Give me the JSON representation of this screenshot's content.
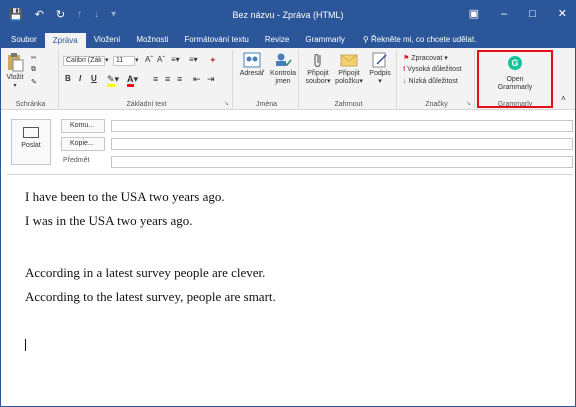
{
  "titlebar": {
    "title": "Bez názvu - Zpráva (HTML)",
    "save_icon": "save-icon",
    "undo_icon": "undo-icon",
    "redo_icon": "redo-icon"
  },
  "tabs": [
    "Soubor",
    "Zpráva",
    "Vložení",
    "Možnosti",
    "Formátování textu",
    "Revize",
    "Grammarly"
  ],
  "tell_me": "Řekněte mi, co chcete udělat.",
  "ribbon": {
    "paste": "Vložit",
    "clipboard_group": "Schránka",
    "font_name": "Calibri (Zák",
    "font_size": "11",
    "basic_text_group": "Základní text",
    "address_book": "Adresář",
    "check_names": [
      "Kontrola",
      "jmen"
    ],
    "names_group": "Jména",
    "attach_file": [
      "Připojit",
      "soubor"
    ],
    "attach_item": [
      "Připojit",
      "položku"
    ],
    "signature": "Podpis",
    "include_group": "Zahrnout",
    "follow_up": "Zpracovat",
    "high_importance": "Vysoká důležitost",
    "low_importance": "Nízká důležitost",
    "tags_group": "Značky",
    "open_grammarly": [
      "Open",
      "Grammarly"
    ],
    "grammarly_group": "Grammarly"
  },
  "header": {
    "send": "Poslat",
    "to": "Komu...",
    "cc": "Kopie...",
    "subject": "Předmět"
  },
  "body": {
    "lines": [
      "I have been to the USA two years ago.",
      "I was in the USA two years ago.",
      "According in a latest survey people are clever.",
      "According to the latest survey, people are smart."
    ]
  },
  "colors": {
    "accent": "#2b579a",
    "highlight": "#e3101b",
    "grammarly": "#15c39a"
  }
}
